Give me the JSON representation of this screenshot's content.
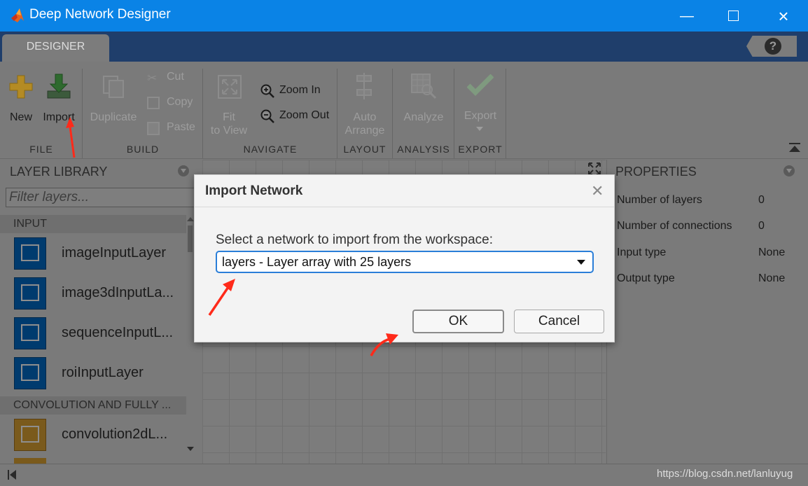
{
  "window": {
    "title": "Deep Network Designer"
  },
  "tabs": [
    {
      "label": "DESIGNER"
    }
  ],
  "help_label": "?",
  "toolstrip": {
    "file": {
      "section": "FILE",
      "new": "New",
      "import": "Import"
    },
    "build": {
      "section": "BUILD",
      "duplicate": "Duplicate",
      "cut": "Cut",
      "copy": "Copy",
      "paste": "Paste"
    },
    "navigate": {
      "section": "NAVIGATE",
      "fit_line1": "Fit",
      "fit_line2": "to View",
      "zoom_in": "Zoom In",
      "zoom_out": "Zoom Out"
    },
    "layout": {
      "section": "LAYOUT",
      "auto_line1": "Auto",
      "auto_line2": "Arrange"
    },
    "analysis": {
      "section": "ANALYSIS",
      "analyze": "Analyze"
    },
    "export": {
      "section": "EXPORT",
      "export": "Export"
    }
  },
  "layer_library": {
    "title": "LAYER LIBRARY",
    "filter_placeholder": "Filter layers...",
    "categories": [
      {
        "name": "INPUT",
        "layers": [
          "imageInputLayer",
          "image3dInputLa...",
          "sequenceInputL...",
          "roiInputLayer"
        ]
      },
      {
        "name": "CONVOLUTION AND FULLY ...",
        "layers": [
          "convolution2dL..."
        ]
      }
    ]
  },
  "properties": {
    "title": "PROPERTIES",
    "rows": [
      {
        "name": "Number of layers",
        "value": "0"
      },
      {
        "name": "Number of connections",
        "value": "0"
      },
      {
        "name": "Input type",
        "value": "None"
      },
      {
        "name": "Output type",
        "value": "None"
      }
    ]
  },
  "dialog": {
    "title": "Import Network",
    "prompt": "Select a network to import from the workspace:",
    "selected": "layers - Layer array with 25 layers",
    "ok": "OK",
    "cancel": "Cancel"
  },
  "watermark": "https://blog.csdn.net/lanluyug",
  "colors": {
    "titlebar": "#0a83e6",
    "tabstrip": "#1f3e6b",
    "annotation_arrow": "#ff2a1a",
    "select_border": "#2a7ed8"
  },
  "icons": [
    "matlab-logo-icon",
    "minimize-icon",
    "maximize-icon",
    "close-icon",
    "help-icon",
    "new-plus-icon",
    "import-arrow-icon",
    "duplicate-icon",
    "cut-icon",
    "copy-icon",
    "paste-icon",
    "fit-to-view-icon",
    "zoom-in-icon",
    "zoom-out-icon",
    "auto-arrange-icon",
    "analyze-icon",
    "export-check-icon",
    "collapse-icon",
    "layer-icon"
  ]
}
